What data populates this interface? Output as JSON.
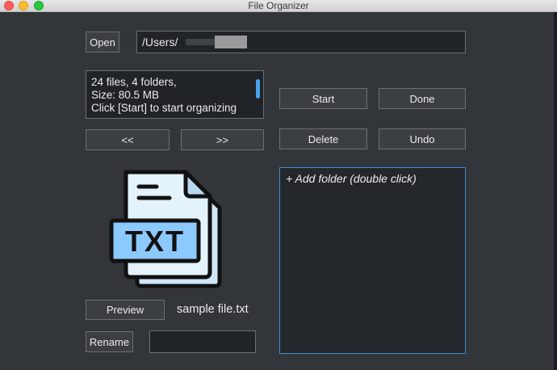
{
  "window": {
    "title": "File Organizer"
  },
  "toolbar": {
    "open_label": "Open",
    "path_value": "/Users/"
  },
  "info": {
    "text": "24 files, 4 folders,\nSize: 80.5 MB\nClick [Start] to start organizing"
  },
  "buttons": {
    "start": "Start",
    "done": "Done",
    "delete": "Delete",
    "undo": "Undo",
    "prev": "<<",
    "next": ">>",
    "preview": "Preview",
    "rename": "Rename"
  },
  "preview": {
    "icon": "txt-file-icon",
    "icon_text": "TXT",
    "filename": "sample file.txt"
  },
  "rename": {
    "value": ""
  },
  "folders": {
    "add_label": "+ Add folder (double click)"
  },
  "colors": {
    "background": "#323539",
    "field_background": "#202327",
    "accent": "#3a8fd8",
    "icon_fill": "#e4f2fb",
    "icon_label": "#8cc9ff"
  }
}
